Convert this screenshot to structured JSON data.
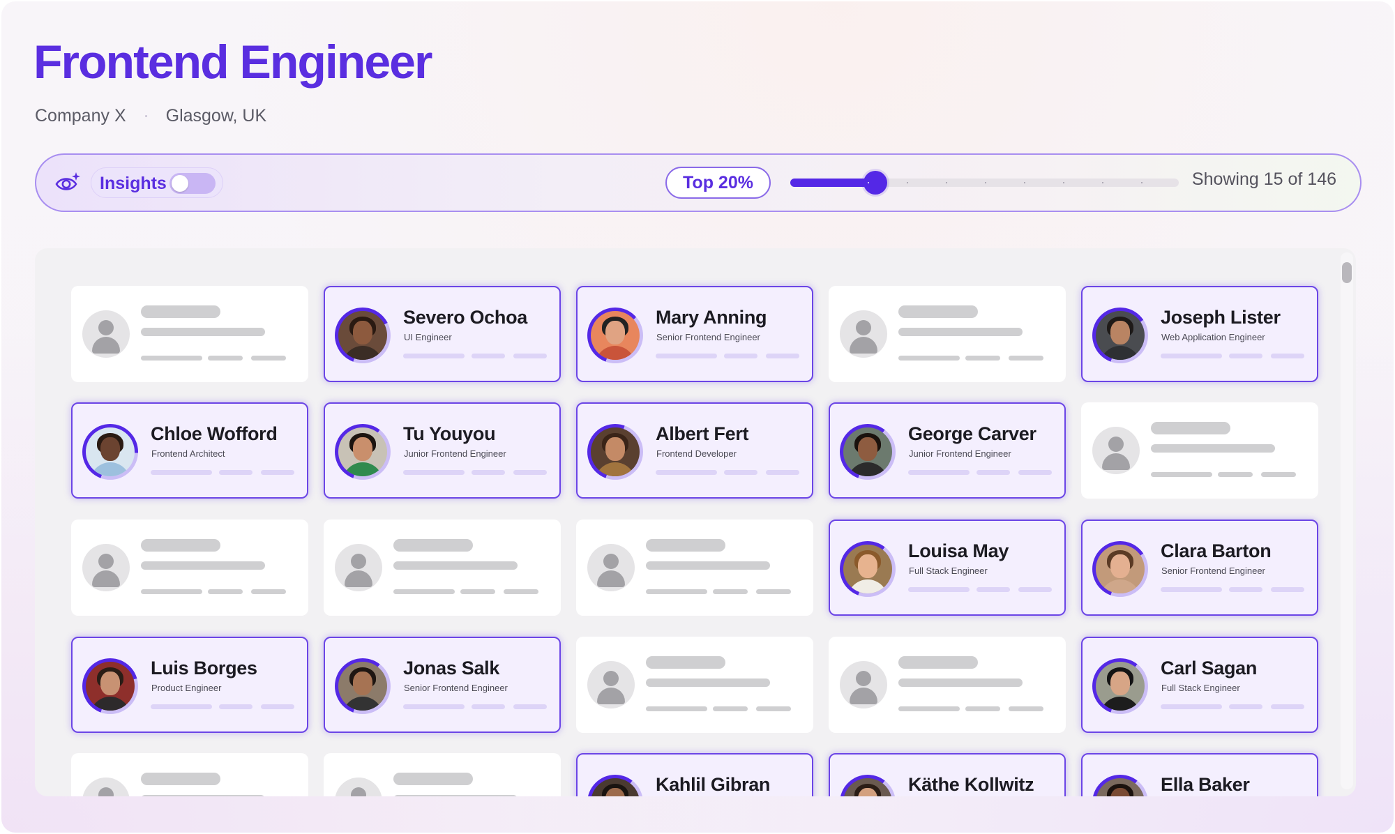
{
  "job": {
    "title": "Frontend Engineer",
    "company": "Company X",
    "location": "Glasgow, UK"
  },
  "toolbar": {
    "insights_icon": "eye-sparkle-icon",
    "insights_label": "Insights",
    "insights_enabled": false,
    "filter_label": "Top 20%",
    "slider_value_fraction": 0.2,
    "slider_steps": 10,
    "showing_text": "Showing 15 of 146"
  },
  "colors": {
    "accent": "#5a2ee0",
    "match_border": "#6b45e6",
    "match_bg": "#f4effe",
    "placeholder": "#cfcfd1"
  },
  "candidates": [
    {
      "row": 0,
      "col": 0,
      "match": false
    },
    {
      "row": 0,
      "col": 1,
      "match": true,
      "name": "Severo Ochoa",
      "role": "UI Engineer",
      "skin": "#8d5a3e",
      "hair": "#2a1a12",
      "shirt": "#3b2d25",
      "bg": "#6a4b3a",
      "ring": 0.62
    },
    {
      "row": 0,
      "col": 2,
      "match": true,
      "name": "Mary Anning",
      "role": "Senior Frontend Engineer",
      "skin": "#e0a383",
      "hair": "#222222",
      "shirt": "#c9543a",
      "bg": "#e8865d",
      "ring": 0.58
    },
    {
      "row": 0,
      "col": 3,
      "match": false
    },
    {
      "row": 0,
      "col": 4,
      "match": true,
      "name": "Joseph Lister",
      "role": "Web Application Engineer",
      "skin": "#b98463",
      "hair": "#1e1a18",
      "shirt": "#2e3033",
      "bg": "#4a4c50",
      "ring": 0.6
    },
    {
      "row": 1,
      "col": 0,
      "match": true,
      "name": "Chloe Wofford",
      "role": "Frontend Architect",
      "skin": "#6b4330",
      "hair": "#2a1b13",
      "shirt": "#9dc0de",
      "bg": "#d9e6f0",
      "ring": 0.7
    },
    {
      "row": 1,
      "col": 1,
      "match": true,
      "name": "Tu Youyou",
      "role": "Junior Frontend Engineer",
      "skin": "#c98f6c",
      "hair": "#1c1410",
      "shirt": "#2f8a4e",
      "bg": "#c8c2b6",
      "ring": 0.55
    },
    {
      "row": 1,
      "col": 2,
      "match": true,
      "name": "Albert Fert",
      "role": "Frontend Developer",
      "skin": "#c48a66",
      "hair": "#3a2418",
      "shirt": "#a1743e",
      "bg": "#5a4030",
      "ring": 0.5
    },
    {
      "row": 1,
      "col": 3,
      "match": true,
      "name": "George Carver",
      "role": "Junior Frontend Engineer",
      "skin": "#8e5c40",
      "hair": "#1a120d",
      "shirt": "#2b2b2b",
      "bg": "#6c7a6e",
      "ring": 0.55
    },
    {
      "row": 1,
      "col": 4,
      "match": false
    },
    {
      "row": 2,
      "col": 0,
      "match": false
    },
    {
      "row": 2,
      "col": 1,
      "match": false
    },
    {
      "row": 2,
      "col": 2,
      "match": false
    },
    {
      "row": 2,
      "col": 3,
      "match": true,
      "name": "Louisa May",
      "role": "Full Stack Engineer",
      "skin": "#e7b38f",
      "hair": "#8b5a2b",
      "shirt": "#f0ede6",
      "bg": "#9a7a52",
      "ring": 0.55
    },
    {
      "row": 2,
      "col": 4,
      "match": true,
      "name": "Clara Barton",
      "role": "Senior Frontend Engineer",
      "skin": "#e4b091",
      "hair": "#5b3b25",
      "shirt": "#cfa78a",
      "bg": "#c29a7a",
      "ring": 0.6
    },
    {
      "row": 3,
      "col": 0,
      "match": true,
      "name": "Luis Borges",
      "role": "Product Engineer",
      "skin": "#c89273",
      "hair": "#2a1d16",
      "shirt": "#2d2a2b",
      "bg": "#8e2f2b",
      "ring": 0.65
    },
    {
      "row": 3,
      "col": 1,
      "match": true,
      "name": "Jonas Salk",
      "role": "Senior Frontend Engineer",
      "skin": "#a67353",
      "hair": "#1e1612",
      "shirt": "#333333",
      "bg": "#8c7b6a",
      "ring": 0.55
    },
    {
      "row": 3,
      "col": 2,
      "match": false
    },
    {
      "row": 3,
      "col": 3,
      "match": false
    },
    {
      "row": 3,
      "col": 4,
      "match": true,
      "name": "Carl Sagan",
      "role": "Full Stack Engineer",
      "skin": "#d7a586",
      "hair": "#141414",
      "shirt": "#1d1d1d",
      "bg": "#9a9c8e",
      "ring": 0.55
    },
    {
      "row": 4,
      "col": 0,
      "match": false
    },
    {
      "row": 4,
      "col": 1,
      "match": false
    },
    {
      "row": 4,
      "col": 2,
      "match": true,
      "name": "Kahlil Gibran",
      "role": "",
      "skin": "#9c6a4c",
      "hair": "#1a1410",
      "shirt": "#3a2a20",
      "bg": "#4a3a30",
      "ring": 0.55
    },
    {
      "row": 4,
      "col": 3,
      "match": true,
      "name": "Käthe Kollwitz",
      "role": "",
      "skin": "#d3a07f",
      "hair": "#2b1d16",
      "shirt": "#5a3d2e",
      "bg": "#6a5a50",
      "ring": 0.55
    },
    {
      "row": 4,
      "col": 4,
      "match": true,
      "name": "Ella Baker",
      "role": "",
      "skin": "#7a4a33",
      "hair": "#1b120e",
      "shirt": "#6a4535",
      "bg": "#7b6a5e",
      "ring": 0.55
    }
  ]
}
